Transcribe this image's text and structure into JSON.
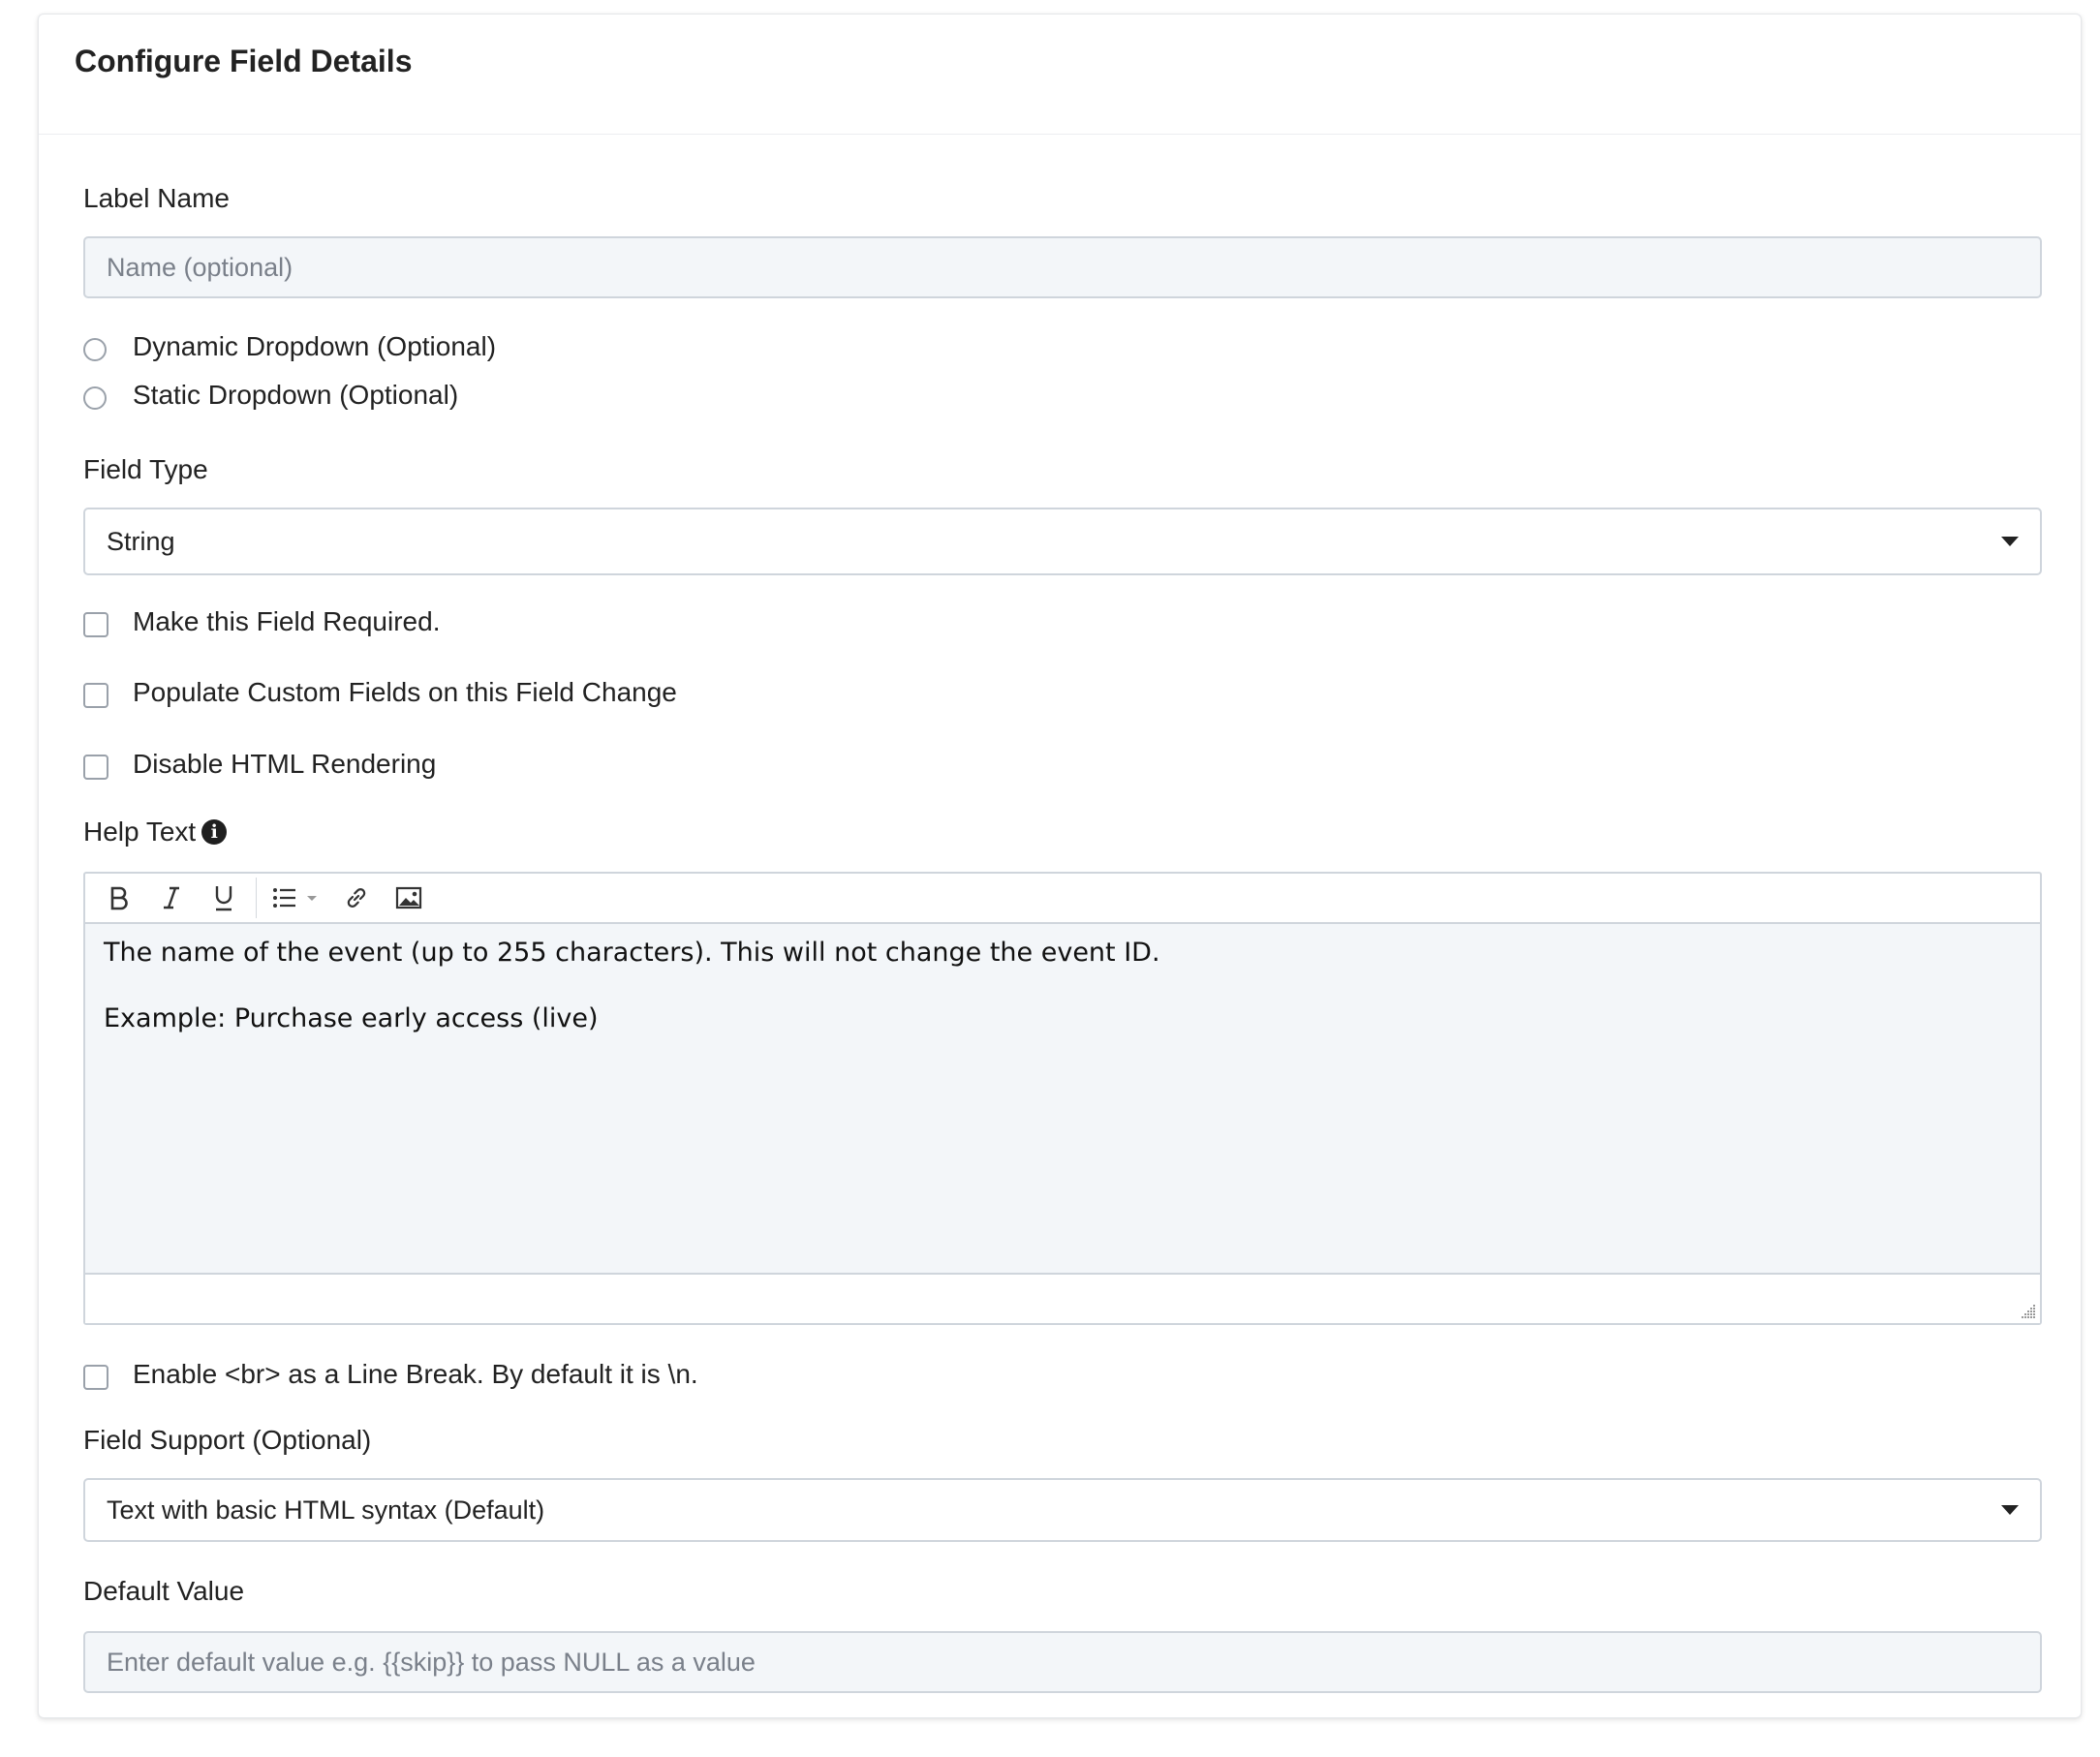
{
  "card": {
    "title": "Configure Field Details"
  },
  "label_name": {
    "label": "Label Name",
    "placeholder": "Name (optional)"
  },
  "dropdown_options": [
    {
      "label": "Dynamic Dropdown (Optional)",
      "selected": false
    },
    {
      "label": "Static Dropdown (Optional)",
      "selected": false
    }
  ],
  "field_type": {
    "label": "Field Type",
    "value": "String"
  },
  "checkboxes": {
    "required": {
      "label": "Make this Field Required.",
      "checked": false
    },
    "populate": {
      "label": "Populate Custom Fields on this Field Change",
      "checked": false
    },
    "disable_html": {
      "label": "Disable HTML Rendering",
      "checked": false
    }
  },
  "help_text": {
    "label": "Help Text",
    "info_icon": "info-circle-icon",
    "toolbar": [
      "bold-icon",
      "italic-icon",
      "underline-icon",
      "bullet-list-icon",
      "link-icon",
      "image-icon"
    ],
    "paragraphs": [
      "The name of the event (up to 255 characters). This will not change the event ID.",
      "Example: Purchase early access (live)"
    ]
  },
  "line_break": {
    "label": "Enable <br> as a Line Break. By default it is \\n.",
    "checked": false
  },
  "field_support": {
    "label": "Field Support (Optional)",
    "value": "Text with basic HTML syntax (Default)"
  },
  "default_value": {
    "label": "Default Value",
    "placeholder": "Enter default value e.g. {{skip}} to pass NULL as a value"
  },
  "colors": {
    "input_bg": "#f3f6f9",
    "border": "#cfd5dc",
    "text": "#222222",
    "placeholder": "#7a808a"
  }
}
